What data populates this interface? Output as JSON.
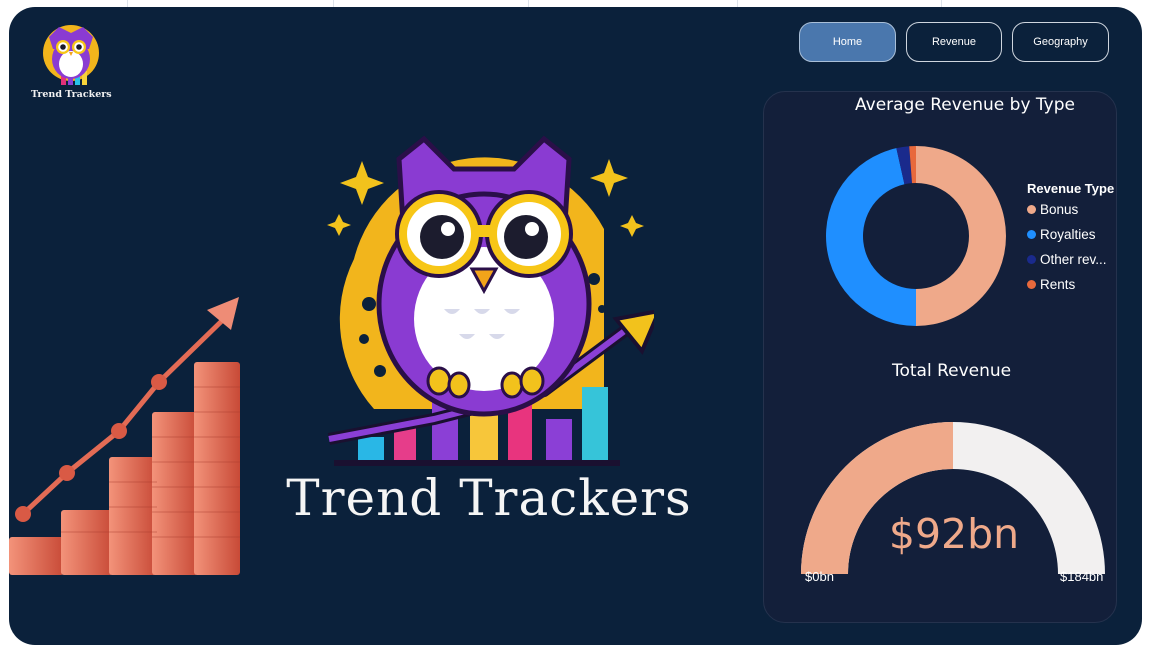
{
  "app": {
    "logo_caption": "Trend Trackers",
    "hero_title": "Trend Trackers"
  },
  "nav": {
    "items": [
      {
        "label": "Home",
        "active": true
      },
      {
        "label": "Revenue",
        "active": false
      },
      {
        "label": "Geography",
        "active": false
      }
    ]
  },
  "icons": {
    "logo": "owl-logo-icon",
    "hero": "owl-mascot-icon",
    "growth": "growth-chart-icon"
  },
  "colors": {
    "background": "#0b213b",
    "card": "#131f3a",
    "nav_active": "#4a77ad",
    "bonus": "#efa98a",
    "royalties": "#1f8fff",
    "other": "#1a2a8c",
    "rents": "#e8693c",
    "gauge_remaining": "#f2f0f0"
  },
  "chart_data": [
    {
      "type": "pie",
      "variant": "donut",
      "title": "Average Revenue by Type",
      "legend_title": "Revenue Type",
      "legend_position": "right",
      "series": [
        {
          "name": "Bonus",
          "value": 50,
          "color": "#efa98a"
        },
        {
          "name": "Royalties",
          "value": 46.5,
          "color": "#1f8fff"
        },
        {
          "name": "Other rev...",
          "value": 2.3,
          "color": "#1a2a8c"
        },
        {
          "name": "Rents",
          "value": 1.2,
          "color": "#e8693c"
        }
      ]
    },
    {
      "type": "gauge",
      "title": "Total Revenue",
      "value": 92,
      "min": 0,
      "max": 184,
      "value_label": "$92bn",
      "min_label": "$0bn",
      "max_label": "$184bn"
    }
  ]
}
